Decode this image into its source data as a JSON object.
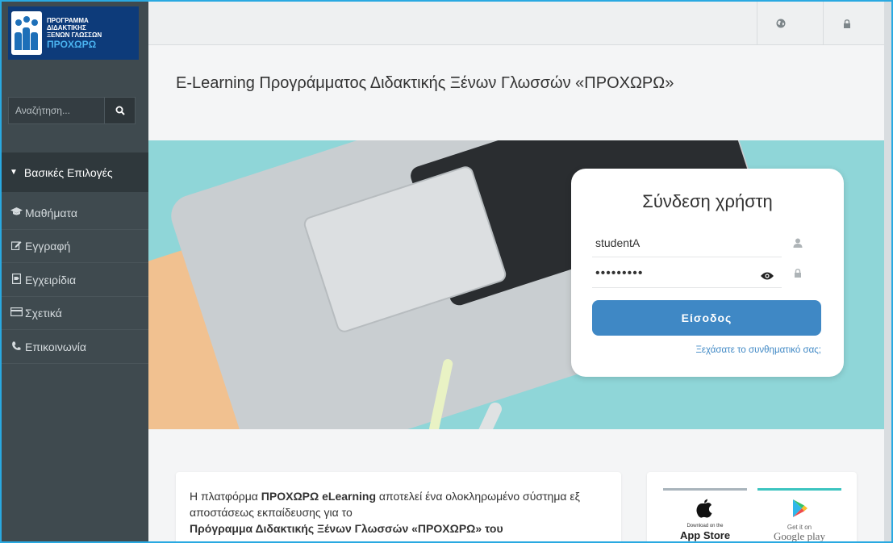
{
  "sidebar": {
    "logo_lines": [
      "ΠΡΟΓΡΑΜΜΑ",
      "ΔΙΔΑΚΤΙΚΗΣ",
      "ΞΕΝΩΝ ΓΛΩΣΣΩΝ"
    ],
    "logo_brand": "ΠΡΟΧΩΡΩ",
    "search_placeholder": "Αναζήτηση...",
    "section_header": "Βασικές Επιλογές",
    "items": [
      {
        "label": "Μαθήματα",
        "icon": "graduation-cap-icon"
      },
      {
        "label": "Εγγραφή",
        "icon": "edit-icon"
      },
      {
        "label": "Εγχειρίδια",
        "icon": "file-icon"
      },
      {
        "label": "Σχετικά",
        "icon": "card-icon"
      },
      {
        "label": "Επικοινωνία",
        "icon": "phone-icon"
      }
    ]
  },
  "topbar": {
    "buttons": [
      {
        "icon": "globe-icon"
      },
      {
        "icon": "lock-icon"
      }
    ]
  },
  "page": {
    "title": "E-Learning Προγράμματος Διδακτικής Ξένων Γλωσσών «ΠΡΟΧΩΡΩ»"
  },
  "login": {
    "title": "Σύνδεση χρήστη",
    "username_value": "studentA",
    "password_value": "•••••••••",
    "submit_label": "Είσοδος",
    "forgot_label": "Ξεχάσατε το συνθηματικό σας;"
  },
  "info": {
    "text_1": "Η πλατφόρμα ",
    "bold_1": "ΠΡΟΧΩΡΩ eLearning",
    "text_2": " αποτελεί ένα ολοκληρωμένο σύστημα εξ αποστάσεως εκπαίδευσης για το",
    "bold_2": "Πρόγραμμα Διδακτικής Ξένων Γλωσσών «ΠΡΟΧΩΡΩ» του"
  },
  "apps": {
    "appstore_small": "Download on the",
    "appstore_big": "App Store",
    "google_small": "Get it on",
    "google_big": "Google play"
  },
  "colors": {
    "accent": "#3f88c5",
    "sidebar": "#3f4a4f",
    "appstore_bar": "#a9b4bc",
    "google_bar": "#3cc4c0"
  }
}
